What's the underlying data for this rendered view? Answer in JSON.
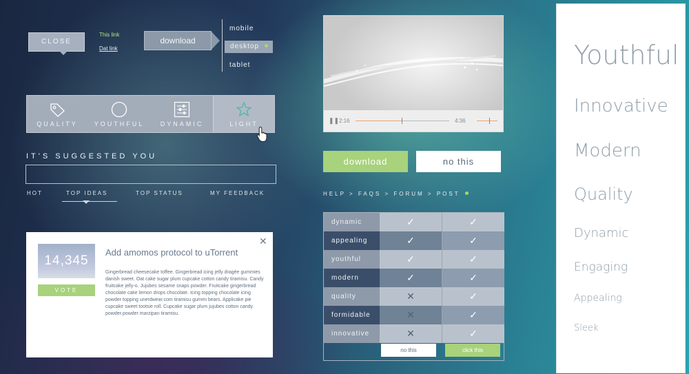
{
  "top_controls": {
    "close_label": "CLOSE",
    "link1": "This link",
    "link2": "Dat link",
    "download_label": "download",
    "devices": [
      "mobile",
      "desktop",
      "tablet"
    ],
    "selected_device": "desktop"
  },
  "icon_bar": {
    "items": [
      {
        "label": "QUALITY",
        "icon": "tag-icon"
      },
      {
        "label": "YOUTHFUL",
        "icon": "circle-icon"
      },
      {
        "label": "DYNAMIC",
        "icon": "sliders-icon"
      },
      {
        "label": "LIGHT",
        "icon": "star-icon"
      }
    ],
    "active": "LIGHT"
  },
  "suggest": {
    "heading": "IT'S SUGGESTED YOU",
    "input_value": "",
    "tabs": [
      "HOT",
      "TOP IDEAS",
      "TOP STATUS",
      "MY FEEDBACK"
    ],
    "active_tab": "TOP IDEAS"
  },
  "card": {
    "count": "14,345",
    "vote_label": "VOTE",
    "title": "Add amomos protocol to uTorrent",
    "body": "Gingerbread cheesecake toffee. Gingerbread icing jelly dragée gummies danish sweet. Oat cake sugar plum cupcake cotton candy tiramisu. Candy fruitcake jelly-o. Jujubes sesame snaps powder. Fruitcake gingerbread chocolate cake lemon drops chocolate. Icing topping chocolate icing powder topping unerdwear.com tiramisu gummi bears. Applicake pie cupcake sweet tootsie roll. Cupcake sugar plum jujubes cotton candy powder powder marzipan tiramisu.",
    "close_glyph": "✕"
  },
  "video": {
    "current_time": "2:16",
    "duration": "4:36",
    "progress": 0.49,
    "volume": 0.6
  },
  "buttons": {
    "download": "download",
    "no_this": "no this"
  },
  "breadcrumb": [
    "HELP",
    "FAQS",
    "FORUM",
    "POST"
  ],
  "table": {
    "rows": [
      {
        "label": "dynamic",
        "col1": "✓",
        "col2": "✓"
      },
      {
        "label": "appealing",
        "col1": "✓",
        "col2": "✓"
      },
      {
        "label": "youthful",
        "col1": "✓",
        "col2": "✓"
      },
      {
        "label": "modern",
        "col1": "✓",
        "col2": "✓"
      },
      {
        "label": "quality",
        "col1": "✕",
        "col2": "✓"
      },
      {
        "label": "formidable",
        "col1": "✕",
        "col2": "✓"
      },
      {
        "label": "innovative",
        "col1": "✕",
        "col2": "✓"
      }
    ],
    "btn_no_this": "no this",
    "btn_click_this": "click this"
  },
  "panel_words": [
    "Youthful",
    "Innovative",
    "Modern",
    "Quality",
    "Dynamic",
    "Engaging",
    "Appealing",
    "Sleek"
  ],
  "colors": {
    "accent_green": "#a8d27c",
    "panel_text": "#8f9ea8"
  }
}
